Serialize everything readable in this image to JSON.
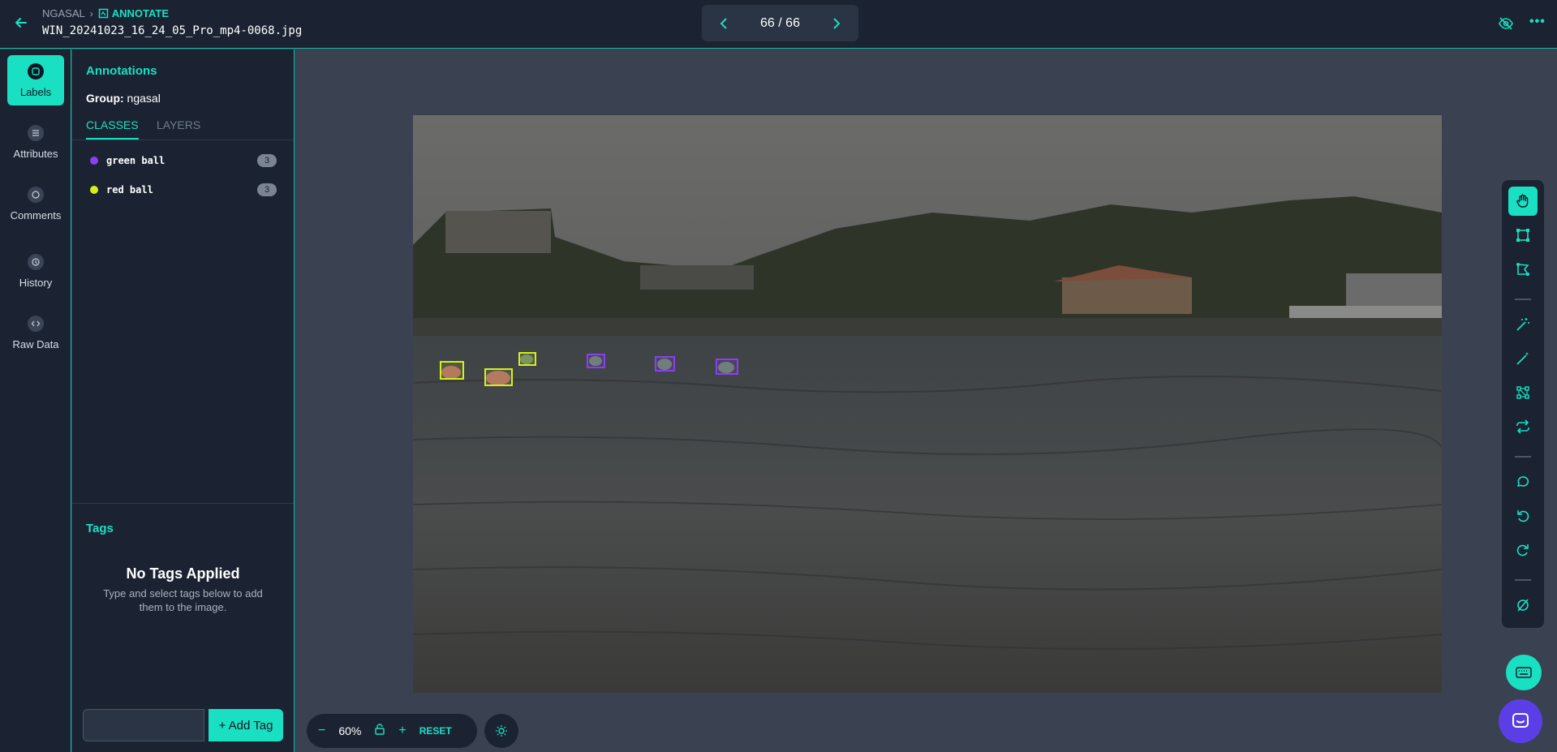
{
  "header": {
    "breadcrumb_root": "NGASAL",
    "breadcrumb_current": "ANNOTATE",
    "filename": "WIN_20241023_16_24_05_Pro_mp4-0068.jpg",
    "pager_text": "66 / 66"
  },
  "leftnav": {
    "items": [
      {
        "label": "Labels",
        "icon": "tag-icon"
      },
      {
        "label": "Attributes",
        "icon": "list-icon"
      },
      {
        "label": "Comments",
        "icon": "comment-icon"
      },
      {
        "label": "History",
        "icon": "history-icon"
      },
      {
        "label": "Raw Data",
        "icon": "code-icon"
      }
    ]
  },
  "panel": {
    "title": "Annotations",
    "group_label": "Group:",
    "group_value": "ngasal",
    "tabs": [
      "CLASSES",
      "LAYERS"
    ],
    "classes": [
      {
        "name": "green ball",
        "count": "3",
        "color": "#8b3ff2"
      },
      {
        "name": "red ball",
        "count": "3",
        "color": "#d4f01a"
      }
    ],
    "tags_title": "Tags",
    "no_tags_title": "No Tags Applied",
    "no_tags_sub": "Type and select tags below to add them to the image.",
    "add_tag_label": "+ Add Tag"
  },
  "zoom": {
    "value": "60%",
    "reset_label": "RESET"
  },
  "colors": {
    "accent": "#19e0c2",
    "background": "#1b2332",
    "red_ball_box": "#d4f01a",
    "green_ball_box": "#8b3ff2"
  }
}
